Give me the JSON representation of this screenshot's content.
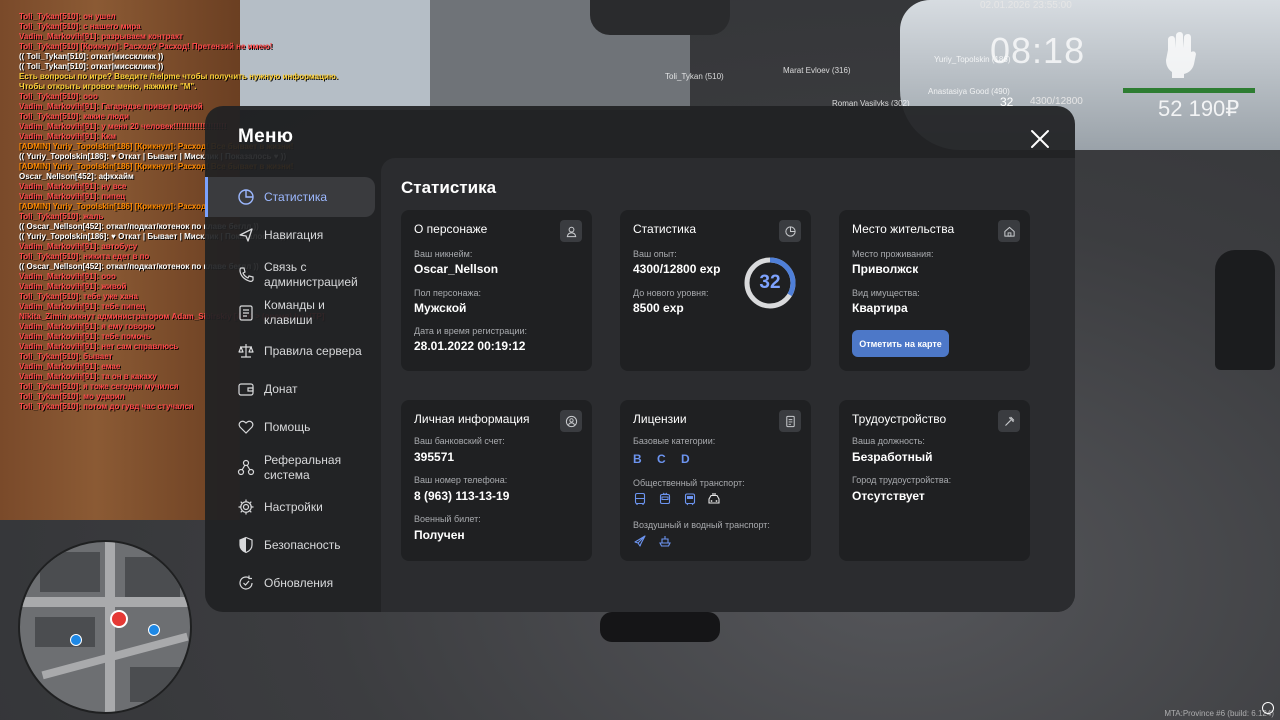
{
  "chat": [
    {
      "text": "Toli_Tykan[510]: он ушел",
      "color": "red"
    },
    {
      "text": "Toli_Tykan[510]: с нашего мира",
      "color": "red"
    },
    {
      "text": "Vadim_Markovih[91]: разрываем контракт",
      "color": "red"
    },
    {
      "text": "Toli_Tykan[510] [Крикнул]: Расход? Расход! Претензий не имею!",
      "color": "red"
    },
    {
      "text": "(( Toli_Tykan[510]: откат|мисскликк ))",
      "color": "white"
    },
    {
      "text": "(( Toli_Tykan[510]: откат|мисскликк ))",
      "color": "white"
    },
    {
      "text": "Есть вопросы по игре? Введите /helpme чтобы получить нужную информацию.",
      "color": "yellow"
    },
    {
      "text": "Чтобы открыть игровое меню, нажмите \"M\".",
      "color": "yellow"
    },
    {
      "text": "Toli_Tykan[510]: ооо",
      "color": "red"
    },
    {
      "text": "Vadim_Markovih[91]: Гагарндзе привет родной",
      "color": "red"
    },
    {
      "text": "Toli_Tykan[510]: какие люди",
      "color": "red"
    },
    {
      "text": "Vadim_Markovih[91]: у меня 20 человек!!!!!!!!!!!!!!!!!!!!",
      "color": "red"
    },
    {
      "text": "Vadim_Markovih[91]: Ккм",
      "color": "red"
    },
    {
      "text": "[ADMIN] Yuriy_Topolskin[186] [Крикнул]: Расход! Все бывает в жизни!",
      "color": "orange"
    },
    {
      "text": "(( Yuriy_Topolskin[186]: ♥ Откат | Бывает | Мисклик | Показалось ♥ ))",
      "color": "white"
    },
    {
      "text": "[ADMIN] Yuriy_Topolskin[186] [Крикнул]: Расход! Все бывает в жизни!",
      "color": "orange"
    },
    {
      "text": "Oscar_Nellson[452]: афкхайм",
      "color": "white"
    },
    {
      "text": "Vadim_Markovih[91]: ну все",
      "color": "red"
    },
    {
      "text": "Vadim_Markovih[91]: пипец",
      "color": "red"
    },
    {
      "text": "[ADMIN] Yuriy_Topolskin[186] [Крикнул]: Расход! Все бывает в жизни!",
      "color": "orange"
    },
    {
      "text": "Toli_Tykan[510]: жаль",
      "color": "red"
    },
    {
      "text": "(( Oscar_Nellson[452]: откат/подкат/котенок по клаве беглл ))",
      "color": "white"
    },
    {
      "text": "(( Yuriy_Topolskin[186]: ♥ Откат | Бывает | Мисклик | Показалось ♥ ))",
      "color": "white"
    },
    {
      "text": "Vadim_Markovih[91]: автобусу",
      "color": "red"
    },
    {
      "text": "Toli_Tykan[510]: никита едет в по",
      "color": "red"
    },
    {
      "text": "(( Oscar_Nellson[452]: откат/подкат/котенок по клаве беглл ))",
      "color": "white"
    },
    {
      "text": "Vadim_Markovih[91]: ооо",
      "color": "red"
    },
    {
      "text": "Vadim_Markovih[91]: живой",
      "color": "red"
    },
    {
      "text": "Toli_Tykan[510]: тебе уже хана",
      "color": "red"
    },
    {
      "text": "Vadim_Markovih[91]: тебе пипец",
      "color": "red"
    },
    {
      "text": "Nikita_Zimin кикнут администратором Adam_Sibirskiy [AFK > (время) by HTP]",
      "color": "red"
    },
    {
      "text": "Vadim_Markovih[91]: я ему говорю",
      "color": "red"
    },
    {
      "text": "Vadim_Markovih[91]: тебе помочь",
      "color": "red"
    },
    {
      "text": "Vadim_Markovih[91]: нет сам справлюсь",
      "color": "red"
    },
    {
      "text": "Toli_Tykan[510]: бывает",
      "color": "red"
    },
    {
      "text": "Vadim_Markovih[91]: емае",
      "color": "red"
    },
    {
      "text": "Vadim_Markovih[91]: та он в какаху",
      "color": "red"
    },
    {
      "text": "Toli_Tykan[510]: я тоже сегодня мучился",
      "color": "red"
    },
    {
      "text": "Toli_Tykan[510]: мо ударил",
      "color": "red"
    },
    {
      "text": "Toli_Tykan[510]: потом до гувд час стучался",
      "color": "red"
    }
  ],
  "hud": {
    "date": "02.01.2026 23:55:00",
    "time": "08:18",
    "level": "32",
    "exp": "4300/12800",
    "money": "52 190₽",
    "health_color": "#2e7d32"
  },
  "nametags": [
    {
      "text": "Toli_Tykan (510)"
    },
    {
      "text": "Marat Evloev (316)"
    },
    {
      "text": "Yuriy_Topolskin (186)"
    },
    {
      "text": "Anastasiya Good (490)"
    },
    {
      "text": "Roman Vasilyks (302)"
    }
  ],
  "build_info": "MTA:Province #6 (build: 6.124)",
  "menu": {
    "title": "Меню",
    "sidebar": [
      {
        "label": "Статистика",
        "icon": "pie-chart-icon",
        "active": true
      },
      {
        "label": "Навигация",
        "icon": "navigation-icon"
      },
      {
        "label": "Связь с администрацией",
        "icon": "phone-icon"
      },
      {
        "label": "Команды и клавиши",
        "icon": "document-icon"
      },
      {
        "label": "Правила сервера",
        "icon": "scales-icon"
      },
      {
        "label": "Донат",
        "icon": "wallet-icon"
      },
      {
        "label": "Помощь",
        "icon": "heart-hand-icon"
      },
      {
        "label": "Реферальная система",
        "icon": "network-icon"
      },
      {
        "label": "Настройки",
        "icon": "gear-icon"
      },
      {
        "label": "Безопасность",
        "icon": "shield-icon"
      },
      {
        "label": "Обновления",
        "icon": "refresh-icon"
      }
    ]
  },
  "content": {
    "title": "Статистика",
    "character": {
      "title": "О персонаже",
      "nickname_label": "Ваш никнейм:",
      "nickname": "Oscar_Nellson",
      "gender_label": "Пол персонажа:",
      "gender": "Мужской",
      "reg_label": "Дата и время регистрации:",
      "reg": "28.01.2022 00:19:12"
    },
    "stats": {
      "title": "Статистика",
      "exp_label": "Ваш опыт:",
      "exp": "4300/12800 exp",
      "next_label": "До нового уровня:",
      "next": "8500 exp",
      "level": "32",
      "progress": 0.336,
      "ring_color": "#4f7fd8"
    },
    "residence": {
      "title": "Место жительства",
      "city_label": "Место проживания:",
      "city": "Приволжск",
      "property_label": "Вид имущества:",
      "property": "Квартира",
      "map_button": "Отметить на карте"
    },
    "personal": {
      "title": "Личная информация",
      "bank_label": "Ваш банковский счет:",
      "bank": "395571",
      "phone_label": "Ваш номер телефона:",
      "phone": "8 (963) 113-13-19",
      "military_label": "Военный билет:",
      "military": "Получен"
    },
    "licenses": {
      "title": "Лицензии",
      "base_label": "Базовые категории:",
      "base": "B C D",
      "public_label": "Общественный транспорт:",
      "public_icons": [
        "bus-icon",
        "trolleybus-icon",
        "tram-icon",
        "taxi-icon"
      ],
      "air_label": "Воздушный и водный транспорт:",
      "air_icons": [
        "plane-icon",
        "boat-icon"
      ],
      "accent": "#6c94f0"
    },
    "employment": {
      "title": "Трудоустройство",
      "position_label": "Ваша должность:",
      "position": "Безработный",
      "city_label": "Город трудоустройства:",
      "city": "Отсутствует"
    }
  }
}
